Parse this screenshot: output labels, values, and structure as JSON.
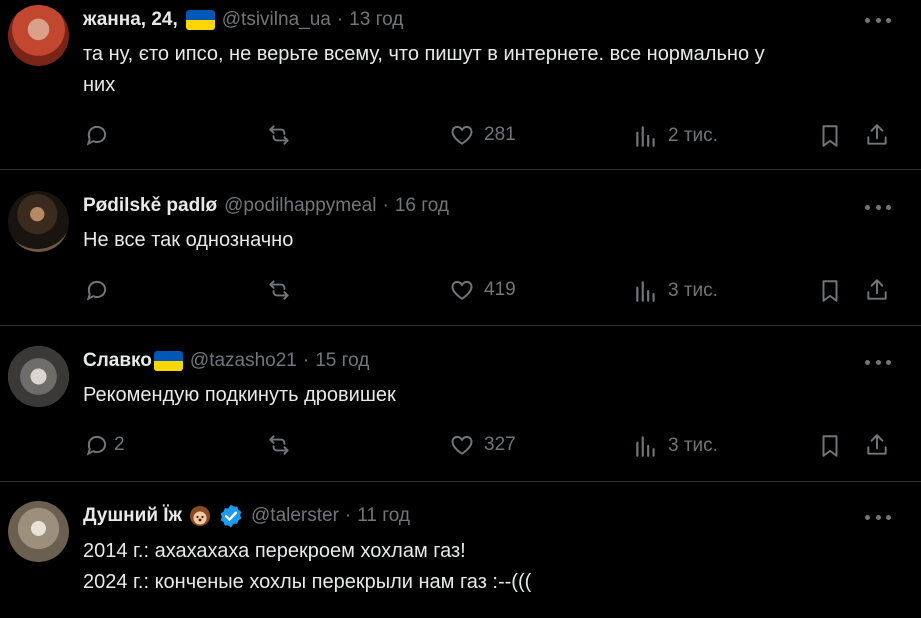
{
  "colors": {
    "background": "#000000",
    "text": "#e7e9ea",
    "muted": "#71767b",
    "divider": "#2f3336",
    "verified": "#1d9bf0"
  },
  "tweets": [
    {
      "name": "жанна, 24,",
      "badge": "ua-flag",
      "handle": "@tsivilna_ua",
      "time": "13 год",
      "text": "та ну, єто ипсо, не верьте всему, что пишут в интернете. все нормально у\nних",
      "replies": "",
      "likes": "281",
      "views": "2 тис."
    },
    {
      "name": "Pødilskě padlø",
      "badge": "",
      "handle": "@podilhappymeal",
      "time": "16 год",
      "text": "Не все так однозначно",
      "replies": "",
      "likes": "419",
      "views": "3 тис."
    },
    {
      "name": "Славко",
      "badge": "ua-flag",
      "handle": "@tazasho21",
      "time": "15 год",
      "text": "Рекомендую подкинуть дровишек",
      "replies": "2",
      "likes": "327",
      "views": "3 тис."
    },
    {
      "name": "Душний Їж",
      "badge": "hedgehog-emoji, verified-badge",
      "handle": "@talerster",
      "time": "11 год",
      "text": "2014 г.: ахахахаха перекроем хохлам газ!\n2024 г.: конченые хохлы перекрыли нам газ :--(((",
      "replies": "",
      "likes": "",
      "views": ""
    }
  ],
  "icons": [
    "reply-icon",
    "retweet-icon",
    "like-icon",
    "views-icon",
    "bookmark-icon",
    "share-icon",
    "more-icon",
    "verified-icon",
    "ua-flag-icon",
    "hedgehog-icon"
  ]
}
